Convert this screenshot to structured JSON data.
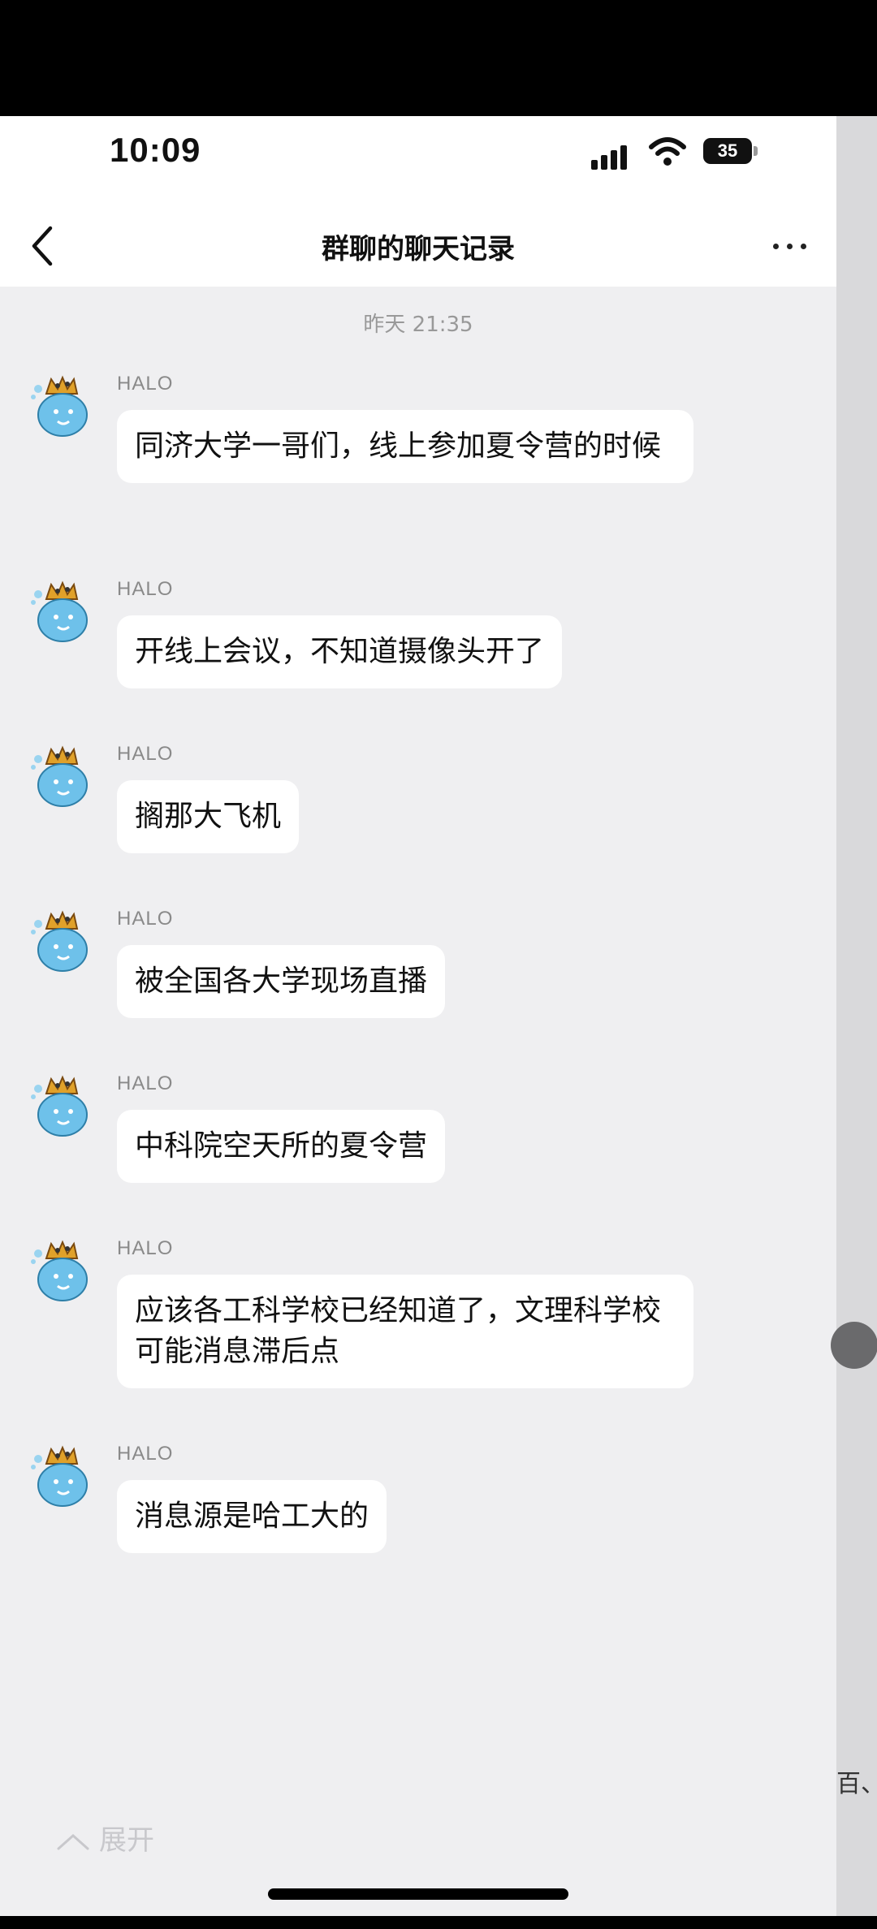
{
  "status_bar": {
    "time": "10:09",
    "battery": "35"
  },
  "header": {
    "title": "群聊的聊天记录"
  },
  "time_separator": "昨天 21:35",
  "messages": [
    {
      "sender": "HALO",
      "text": "同济大学一哥们，线上参加夏令营的时候"
    },
    {
      "sender": "HALO",
      "text": "开线上会议，不知道摄像头开了"
    },
    {
      "sender": "HALO",
      "text": "搁那大飞机"
    },
    {
      "sender": "HALO",
      "text": "被全国各大学现场直播"
    },
    {
      "sender": "HALO",
      "text": "中科院空天所的夏令营"
    },
    {
      "sender": "HALO",
      "text": "应该各工科学校已经知道了，文理科学校可能消息滞后点"
    },
    {
      "sender": "HALO",
      "text": "消息源是哈工大的"
    }
  ],
  "footer": {
    "expand_label": "展开",
    "corner_text": "百、"
  },
  "colors": {
    "background": "#efeff1",
    "bubble": "#ffffff",
    "avatar": "#6ec1ea"
  },
  "icons": [
    "back-chevron-icon",
    "more-icon",
    "signal-icon",
    "wifi-icon",
    "battery-icon",
    "chevron-up-icon",
    "avatar-whale-icon"
  ]
}
